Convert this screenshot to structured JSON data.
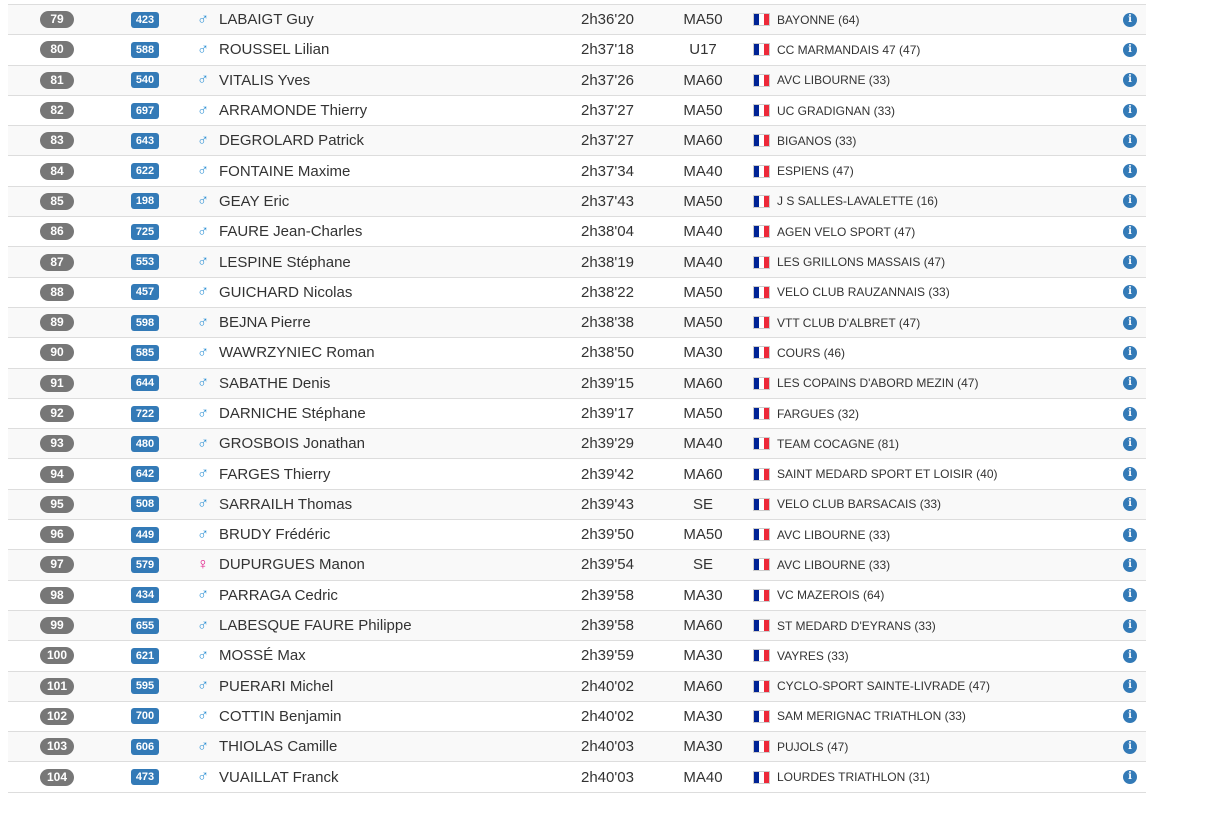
{
  "results": [
    {
      "rank": "79",
      "bib": "423",
      "gender": "male",
      "name": "LABAIGT Guy",
      "time": "2h36'20",
      "category": "MA50",
      "club": "BAYONNE (64)"
    },
    {
      "rank": "80",
      "bib": "588",
      "gender": "male",
      "name": "ROUSSEL Lilian",
      "time": "2h37'18",
      "category": "U17",
      "club": "CC MARMANDAIS 47 (47)"
    },
    {
      "rank": "81",
      "bib": "540",
      "gender": "male",
      "name": "VITALIS Yves",
      "time": "2h37'26",
      "category": "MA60",
      "club": "AVC LIBOURNE (33)"
    },
    {
      "rank": "82",
      "bib": "697",
      "gender": "male",
      "name": "ARRAMONDE Thierry",
      "time": "2h37'27",
      "category": "MA50",
      "club": "UC GRADIGNAN (33)"
    },
    {
      "rank": "83",
      "bib": "643",
      "gender": "male",
      "name": "DEGROLARD Patrick",
      "time": "2h37'27",
      "category": "MA60",
      "club": "BIGANOS (33)"
    },
    {
      "rank": "84",
      "bib": "622",
      "gender": "male",
      "name": "FONTAINE Maxime",
      "time": "2h37'34",
      "category": "MA40",
      "club": "ESPIENS (47)"
    },
    {
      "rank": "85",
      "bib": "198",
      "gender": "male",
      "name": "GEAY Eric",
      "time": "2h37'43",
      "category": "MA50",
      "club": "J S SALLES-LAVALETTE (16)"
    },
    {
      "rank": "86",
      "bib": "725",
      "gender": "male",
      "name": "FAURE Jean-Charles",
      "time": "2h38'04",
      "category": "MA40",
      "club": "AGEN VELO SPORT (47)"
    },
    {
      "rank": "87",
      "bib": "553",
      "gender": "male",
      "name": "LESPINE Stéphane",
      "time": "2h38'19",
      "category": "MA40",
      "club": "LES GRILLONS MASSAIS (47)"
    },
    {
      "rank": "88",
      "bib": "457",
      "gender": "male",
      "name": "GUICHARD Nicolas",
      "time": "2h38'22",
      "category": "MA50",
      "club": "VELO CLUB RAUZANNAIS (33)"
    },
    {
      "rank": "89",
      "bib": "598",
      "gender": "male",
      "name": "BEJNA Pierre",
      "time": "2h38'38",
      "category": "MA50",
      "club": "VTT CLUB D'ALBRET (47)"
    },
    {
      "rank": "90",
      "bib": "585",
      "gender": "male",
      "name": "WAWRZYNIEC Roman",
      "time": "2h38'50",
      "category": "MA30",
      "club": "COURS (46)"
    },
    {
      "rank": "91",
      "bib": "644",
      "gender": "male",
      "name": "SABATHE Denis",
      "time": "2h39'15",
      "category": "MA60",
      "club": "LES COPAINS D'ABORD MEZIN (47)"
    },
    {
      "rank": "92",
      "bib": "722",
      "gender": "male",
      "name": "DARNICHE Stéphane",
      "time": "2h39'17",
      "category": "MA50",
      "club": "FARGUES (32)"
    },
    {
      "rank": "93",
      "bib": "480",
      "gender": "male",
      "name": "GROSBOIS Jonathan",
      "time": "2h39'29",
      "category": "MA40",
      "club": "TEAM COCAGNE (81)"
    },
    {
      "rank": "94",
      "bib": "642",
      "gender": "male",
      "name": "FARGES Thierry",
      "time": "2h39'42",
      "category": "MA60",
      "club": "SAINT MEDARD SPORT ET LOISIR (40)"
    },
    {
      "rank": "95",
      "bib": "508",
      "gender": "male",
      "name": "SARRAILH Thomas",
      "time": "2h39'43",
      "category": "SE",
      "club": "VELO CLUB BARSACAIS (33)"
    },
    {
      "rank": "96",
      "bib": "449",
      "gender": "male",
      "name": "BRUDY Frédéric",
      "time": "2h39'50",
      "category": "MA50",
      "club": "AVC LIBOURNE (33)"
    },
    {
      "rank": "97",
      "bib": "579",
      "gender": "female",
      "name": "DUPURGUES Manon",
      "time": "2h39'54",
      "category": "SE",
      "club": "AVC LIBOURNE (33)"
    },
    {
      "rank": "98",
      "bib": "434",
      "gender": "male",
      "name": "PARRAGA Cedric",
      "time": "2h39'58",
      "category": "MA30",
      "club": "VC MAZEROIS (64)"
    },
    {
      "rank": "99",
      "bib": "655",
      "gender": "male",
      "name": "LABESQUE FAURE Philippe",
      "time": "2h39'58",
      "category": "MA60",
      "club": "ST MEDARD D'EYRANS (33)"
    },
    {
      "rank": "100",
      "bib": "621",
      "gender": "male",
      "name": "MOSSÉ Max",
      "time": "2h39'59",
      "category": "MA30",
      "club": "VAYRES (33)"
    },
    {
      "rank": "101",
      "bib": "595",
      "gender": "male",
      "name": "PUERARI Michel",
      "time": "2h40'02",
      "category": "MA60",
      "club": "CYCLO-SPORT SAINTE-LIVRADE (47)"
    },
    {
      "rank": "102",
      "bib": "700",
      "gender": "male",
      "name": "COTTIN Benjamin",
      "time": "2h40'02",
      "category": "MA30",
      "club": "SAM MERIGNAC TRIATHLON (33)"
    },
    {
      "rank": "103",
      "bib": "606",
      "gender": "male",
      "name": "THIOLAS Camille",
      "time": "2h40'03",
      "category": "MA30",
      "club": "PUJOLS (47)"
    },
    {
      "rank": "104",
      "bib": "473",
      "gender": "male",
      "name": "VUAILLAT Franck",
      "time": "2h40'03",
      "category": "MA40",
      "club": "LOURDES TRIATHLON (31)"
    }
  ],
  "icons": {
    "male": "♂",
    "female": "♀",
    "info": "i",
    "flag": "france-flag-icon"
  },
  "colors": {
    "rank_badge": "#777777",
    "bib_badge": "#337ab7",
    "male": "#2a8fd4",
    "female": "#e0218a",
    "info": "#337ab7"
  }
}
